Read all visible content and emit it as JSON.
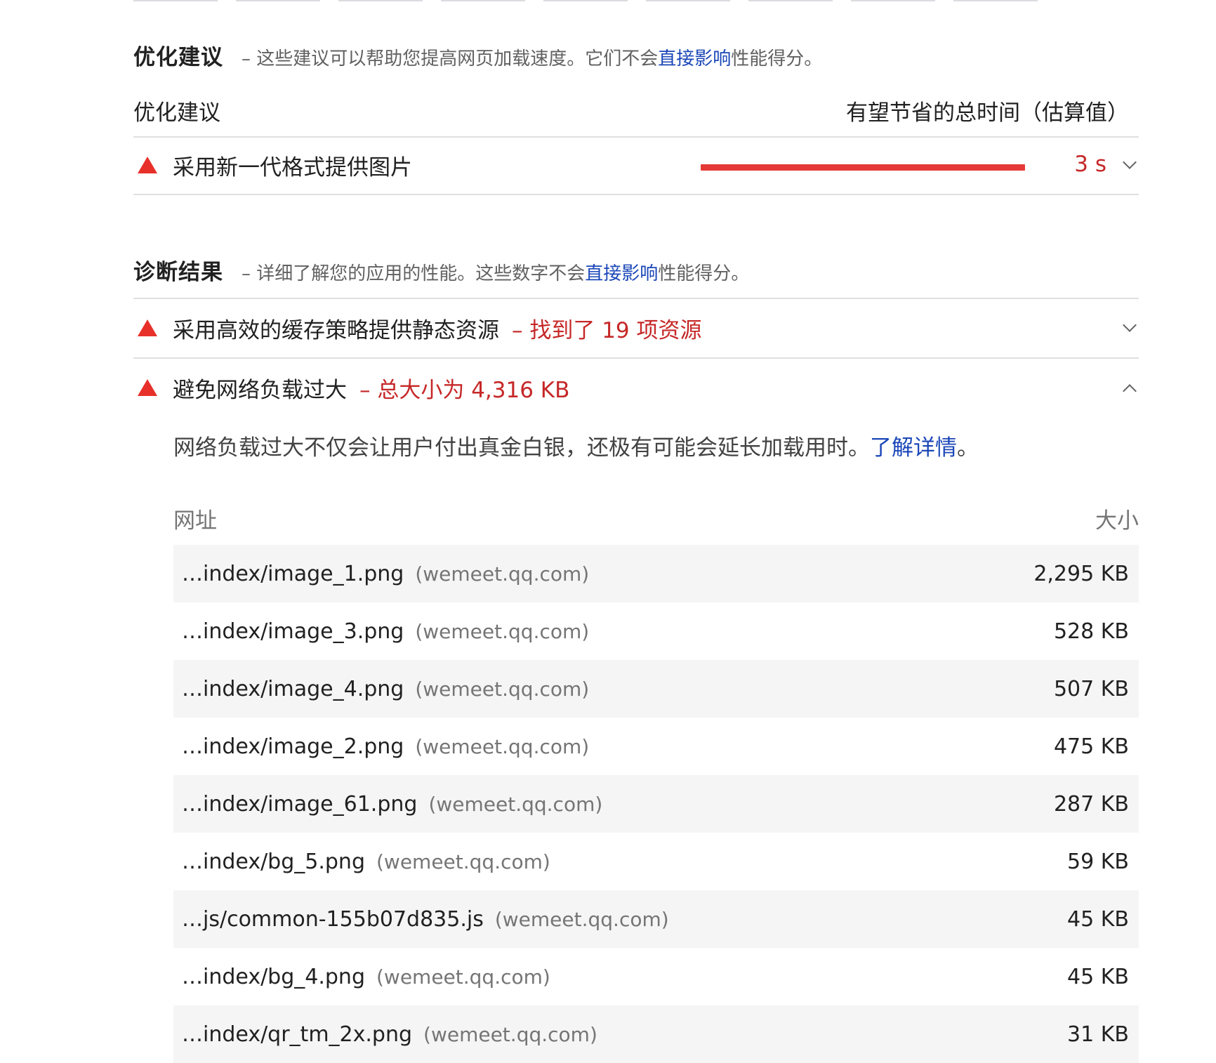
{
  "opportunities": {
    "title": "优化建议",
    "desc_prefix": "– 这些建议可以帮助您提高网页加载速度。它们不会",
    "desc_link": "直接影响",
    "desc_suffix": "性能得分。",
    "col_left": "优化建议",
    "col_right": "有望节省的总时间（估算值）",
    "items": [
      {
        "title": "采用新一代格式提供图片",
        "savings": "3 s",
        "savings_fraction": 1.0
      }
    ]
  },
  "diagnostics": {
    "title": "诊断结果",
    "desc_prefix": "– 详细了解您的应用的性能。这些数字不会",
    "desc_link": "直接影响",
    "desc_suffix": "性能得分。",
    "items": [
      {
        "title": "采用高效的缓存策略提供静态资源",
        "display": "– 找到了 19 项资源",
        "expanded": false
      },
      {
        "title": "避免网络负载过大",
        "display": "– 总大小为 4,316 KB",
        "expanded": true,
        "description": "网络负载过大不仅会让用户付出真金白银，还极有可能会延长加载用时。",
        "learn_more": "了解详情",
        "learn_more_suffix": "。",
        "table": {
          "col_url": "网址",
          "col_size": "大小",
          "rows": [
            {
              "url": "…index/image_1.png",
              "host": "(wemeet.qq.com)",
              "size": "2,295 KB"
            },
            {
              "url": "…index/image_3.png",
              "host": "(wemeet.qq.com)",
              "size": "528 KB"
            },
            {
              "url": "…index/image_4.png",
              "host": "(wemeet.qq.com)",
              "size": "507 KB"
            },
            {
              "url": "…index/image_2.png",
              "host": "(wemeet.qq.com)",
              "size": "475 KB"
            },
            {
              "url": "…index/image_61.png",
              "host": "(wemeet.qq.com)",
              "size": "287 KB"
            },
            {
              "url": "…index/bg_5.png",
              "host": "(wemeet.qq.com)",
              "size": "59 KB"
            },
            {
              "url": "…js/common-155b07d835.js",
              "host": "(wemeet.qq.com)",
              "size": "45 KB"
            },
            {
              "url": "…index/bg_4.png",
              "host": "(wemeet.qq.com)",
              "size": "45 KB"
            },
            {
              "url": "…index/qr_tm_2x.png",
              "host": "(wemeet.qq.com)",
              "size": "31 KB"
            }
          ]
        }
      }
    ]
  },
  "colors": {
    "fail": "#e8302a",
    "fail_text": "#c62828",
    "link": "#1a46b8",
    "row_shade": "#f5f5f5"
  },
  "icons": {
    "fail": "warning-triangle-icon",
    "collapsed": "chevron-down-icon",
    "expanded": "chevron-up-icon"
  }
}
